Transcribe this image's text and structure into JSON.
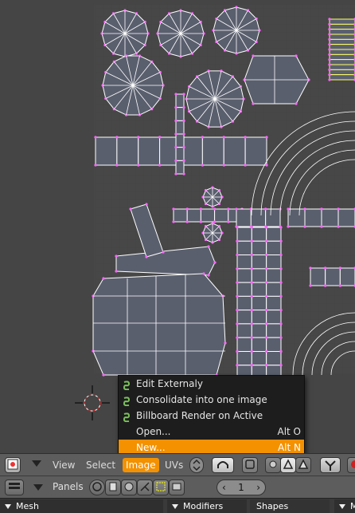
{
  "menu": {
    "items": [
      {
        "label": "Edit Externaly",
        "shortcut": "",
        "icon": "python-script-icon",
        "highlighted": false
      },
      {
        "label": "Consolidate into one image",
        "shortcut": "",
        "icon": "python-script-icon",
        "highlighted": false
      },
      {
        "label": "Billboard Render on Active",
        "shortcut": "",
        "icon": "python-script-icon",
        "highlighted": false
      },
      {
        "label": "Open...",
        "shortcut": "Alt O",
        "icon": "",
        "highlighted": false
      },
      {
        "label": "New...",
        "shortcut": "Alt N",
        "icon": "",
        "highlighted": true
      }
    ]
  },
  "header": {
    "menus": {
      "view": "View",
      "select": "Select",
      "image": "Image",
      "uvs": "UVs"
    },
    "active_menu": "Image",
    "accent_color": "#f39100"
  },
  "panels": {
    "label": "Panels",
    "page_value": "1"
  },
  "tabs": {
    "mesh": "Mesh",
    "modifiers": "Modifiers",
    "shapes": "Shapes",
    "partial": "M"
  },
  "colors": {
    "grid_bg": "#474747",
    "uv_face": "#5a5f6e",
    "uv_edge": "#ffffff",
    "uv_vertex": "#ff66ff",
    "uv_selected_edge": "#ffff66",
    "menu_bg": "#1d1d1d"
  }
}
